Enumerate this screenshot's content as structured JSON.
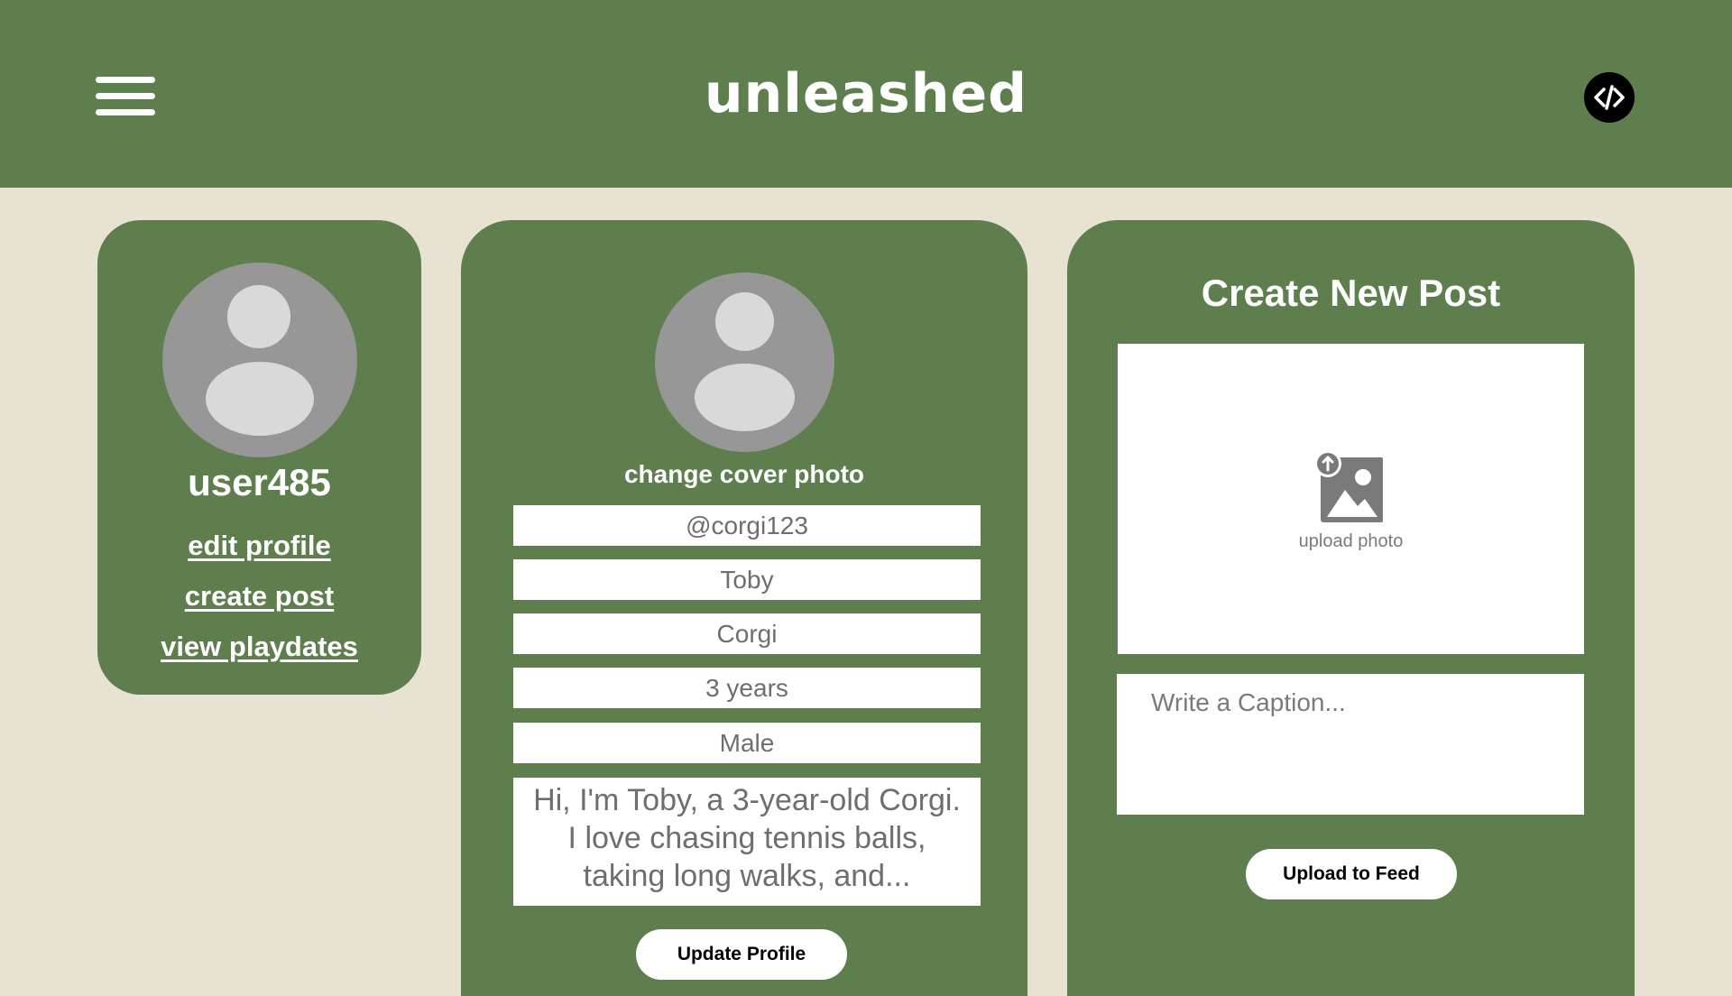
{
  "header": {
    "app_title": "unleashed",
    "menu_icon": "hamburger-menu-icon",
    "code_icon": "code-brackets-icon"
  },
  "sidebar": {
    "username": "user485",
    "links": [
      {
        "label": "edit profile"
      },
      {
        "label": "create post"
      },
      {
        "label": "view playdates"
      }
    ]
  },
  "profile_form": {
    "change_cover_label": "change cover photo",
    "handle": "@corgi123",
    "name": "Toby",
    "breed": "Corgi",
    "age": "3 years",
    "gender": "Male",
    "bio": "Hi, I'm Toby, a 3-year-old Corgi. I love chasing tennis balls, taking long walks, and...",
    "update_button_label": "Update Profile"
  },
  "new_post": {
    "title": "Create New Post",
    "upload_label": "upload photo",
    "upload_icon": "image-upload-icon",
    "caption_placeholder": "Write a Caption...",
    "upload_button_label": "Upload to Feed"
  },
  "colors": {
    "green": "#5f7e4d",
    "cream": "#e8e2d3",
    "avatar_gray": "#979797",
    "avatar_light": "#d9d9d9",
    "text_gray": "#6e6e6e"
  }
}
